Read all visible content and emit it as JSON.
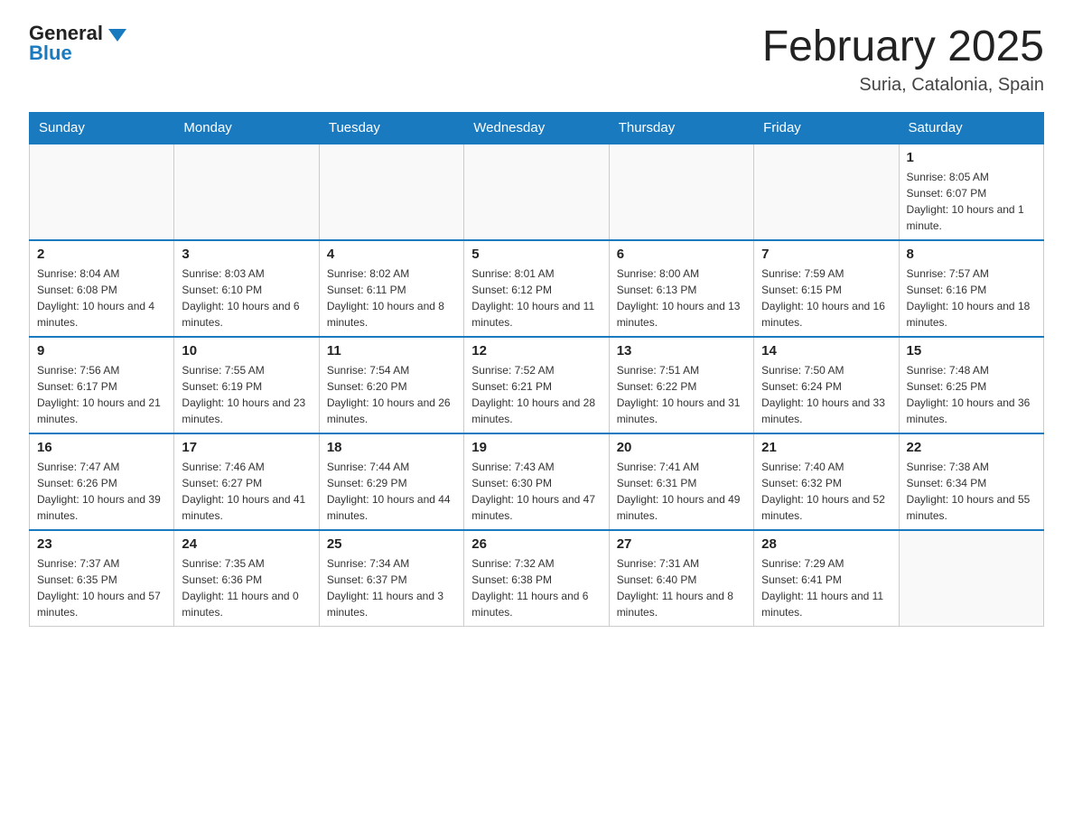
{
  "logo": {
    "general": "General",
    "blue": "Blue"
  },
  "header": {
    "month_title": "February 2025",
    "location": "Suria, Catalonia, Spain"
  },
  "days_of_week": [
    "Sunday",
    "Monday",
    "Tuesday",
    "Wednesday",
    "Thursday",
    "Friday",
    "Saturday"
  ],
  "weeks": [
    [
      {
        "day": "",
        "info": ""
      },
      {
        "day": "",
        "info": ""
      },
      {
        "day": "",
        "info": ""
      },
      {
        "day": "",
        "info": ""
      },
      {
        "day": "",
        "info": ""
      },
      {
        "day": "",
        "info": ""
      },
      {
        "day": "1",
        "info": "Sunrise: 8:05 AM\nSunset: 6:07 PM\nDaylight: 10 hours and 1 minute."
      }
    ],
    [
      {
        "day": "2",
        "info": "Sunrise: 8:04 AM\nSunset: 6:08 PM\nDaylight: 10 hours and 4 minutes."
      },
      {
        "day": "3",
        "info": "Sunrise: 8:03 AM\nSunset: 6:10 PM\nDaylight: 10 hours and 6 minutes."
      },
      {
        "day": "4",
        "info": "Sunrise: 8:02 AM\nSunset: 6:11 PM\nDaylight: 10 hours and 8 minutes."
      },
      {
        "day": "5",
        "info": "Sunrise: 8:01 AM\nSunset: 6:12 PM\nDaylight: 10 hours and 11 minutes."
      },
      {
        "day": "6",
        "info": "Sunrise: 8:00 AM\nSunset: 6:13 PM\nDaylight: 10 hours and 13 minutes."
      },
      {
        "day": "7",
        "info": "Sunrise: 7:59 AM\nSunset: 6:15 PM\nDaylight: 10 hours and 16 minutes."
      },
      {
        "day": "8",
        "info": "Sunrise: 7:57 AM\nSunset: 6:16 PM\nDaylight: 10 hours and 18 minutes."
      }
    ],
    [
      {
        "day": "9",
        "info": "Sunrise: 7:56 AM\nSunset: 6:17 PM\nDaylight: 10 hours and 21 minutes."
      },
      {
        "day": "10",
        "info": "Sunrise: 7:55 AM\nSunset: 6:19 PM\nDaylight: 10 hours and 23 minutes."
      },
      {
        "day": "11",
        "info": "Sunrise: 7:54 AM\nSunset: 6:20 PM\nDaylight: 10 hours and 26 minutes."
      },
      {
        "day": "12",
        "info": "Sunrise: 7:52 AM\nSunset: 6:21 PM\nDaylight: 10 hours and 28 minutes."
      },
      {
        "day": "13",
        "info": "Sunrise: 7:51 AM\nSunset: 6:22 PM\nDaylight: 10 hours and 31 minutes."
      },
      {
        "day": "14",
        "info": "Sunrise: 7:50 AM\nSunset: 6:24 PM\nDaylight: 10 hours and 33 minutes."
      },
      {
        "day": "15",
        "info": "Sunrise: 7:48 AM\nSunset: 6:25 PM\nDaylight: 10 hours and 36 minutes."
      }
    ],
    [
      {
        "day": "16",
        "info": "Sunrise: 7:47 AM\nSunset: 6:26 PM\nDaylight: 10 hours and 39 minutes."
      },
      {
        "day": "17",
        "info": "Sunrise: 7:46 AM\nSunset: 6:27 PM\nDaylight: 10 hours and 41 minutes."
      },
      {
        "day": "18",
        "info": "Sunrise: 7:44 AM\nSunset: 6:29 PM\nDaylight: 10 hours and 44 minutes."
      },
      {
        "day": "19",
        "info": "Sunrise: 7:43 AM\nSunset: 6:30 PM\nDaylight: 10 hours and 47 minutes."
      },
      {
        "day": "20",
        "info": "Sunrise: 7:41 AM\nSunset: 6:31 PM\nDaylight: 10 hours and 49 minutes."
      },
      {
        "day": "21",
        "info": "Sunrise: 7:40 AM\nSunset: 6:32 PM\nDaylight: 10 hours and 52 minutes."
      },
      {
        "day": "22",
        "info": "Sunrise: 7:38 AM\nSunset: 6:34 PM\nDaylight: 10 hours and 55 minutes."
      }
    ],
    [
      {
        "day": "23",
        "info": "Sunrise: 7:37 AM\nSunset: 6:35 PM\nDaylight: 10 hours and 57 minutes."
      },
      {
        "day": "24",
        "info": "Sunrise: 7:35 AM\nSunset: 6:36 PM\nDaylight: 11 hours and 0 minutes."
      },
      {
        "day": "25",
        "info": "Sunrise: 7:34 AM\nSunset: 6:37 PM\nDaylight: 11 hours and 3 minutes."
      },
      {
        "day": "26",
        "info": "Sunrise: 7:32 AM\nSunset: 6:38 PM\nDaylight: 11 hours and 6 minutes."
      },
      {
        "day": "27",
        "info": "Sunrise: 7:31 AM\nSunset: 6:40 PM\nDaylight: 11 hours and 8 minutes."
      },
      {
        "day": "28",
        "info": "Sunrise: 7:29 AM\nSunset: 6:41 PM\nDaylight: 11 hours and 11 minutes."
      },
      {
        "day": "",
        "info": ""
      }
    ]
  ]
}
